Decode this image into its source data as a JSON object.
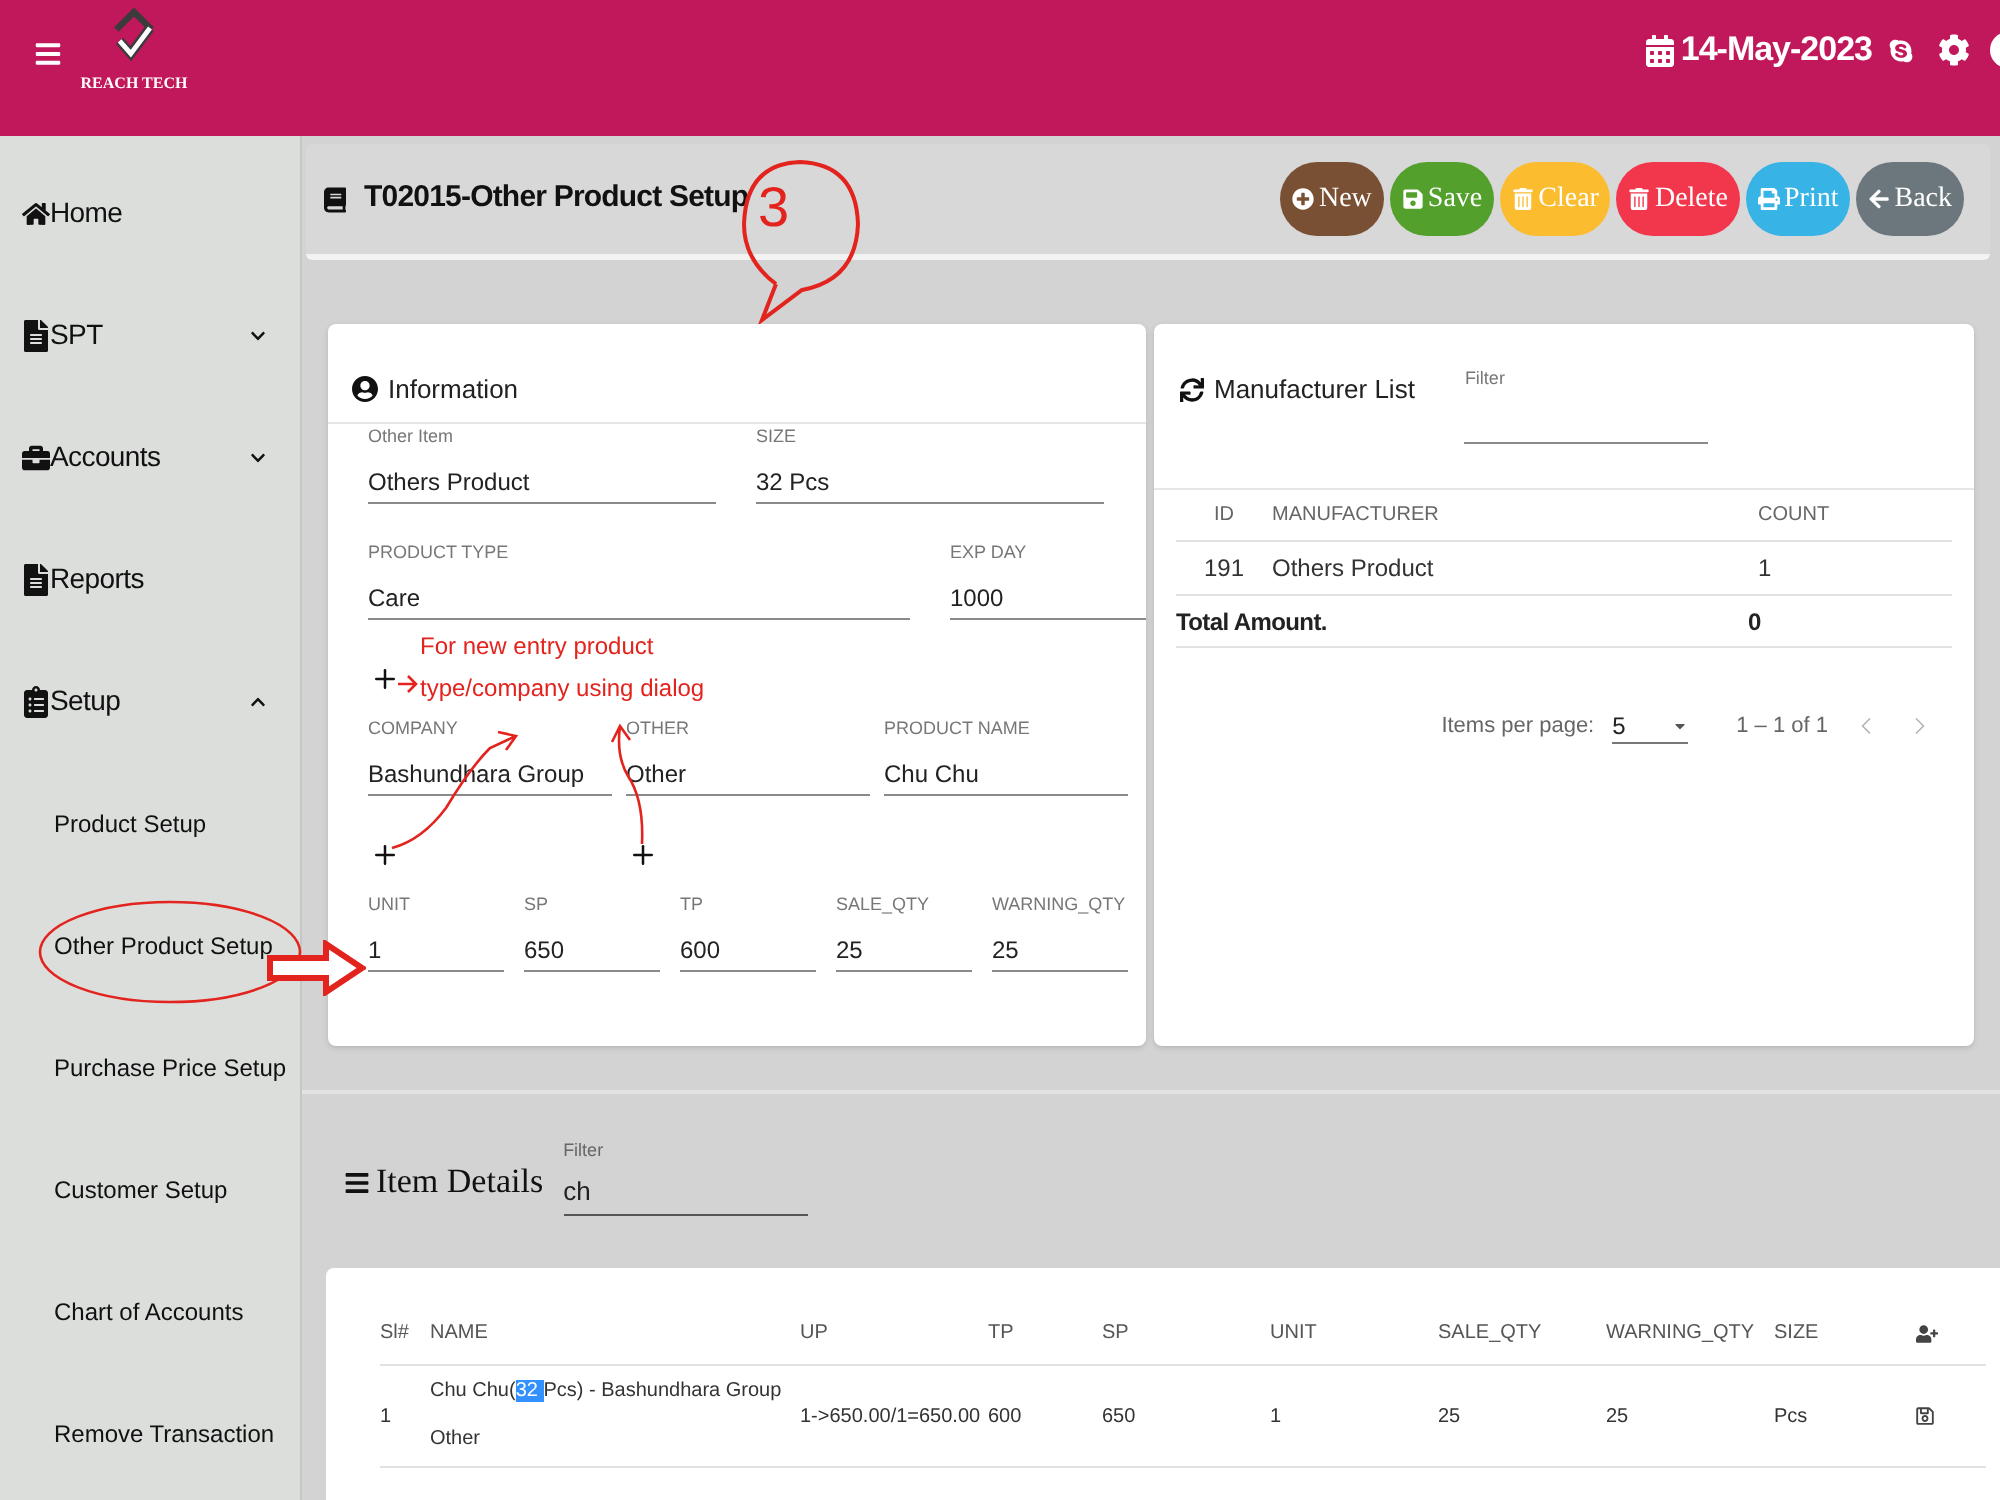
{
  "top_bar": {
    "logo_text": "REACH TECH",
    "date": "14-May-2023"
  },
  "sidebar": {
    "items": [
      {
        "label": "Home",
        "kind": "link"
      },
      {
        "label": "SPT",
        "kind": "group",
        "expanded": false
      },
      {
        "label": "Accounts",
        "kind": "group",
        "expanded": false
      },
      {
        "label": "Reports",
        "kind": "link"
      },
      {
        "label": "Setup",
        "kind": "group",
        "expanded": true,
        "children": [
          {
            "label": "Product Setup"
          },
          {
            "label": "Other Product Setup"
          },
          {
            "label": "Purchase Price Setup"
          },
          {
            "label": "Customer Setup"
          },
          {
            "label": "Chart of Accounts"
          },
          {
            "label": "Remove Transaction"
          }
        ]
      }
    ]
  },
  "page_header": {
    "title": "T02015-Other Product Setup",
    "buttons": [
      {
        "label": "New",
        "color": "#7a5034"
      },
      {
        "label": "Save",
        "color": "#53a02c"
      },
      {
        "label": "Clear",
        "color": "#fbbd2f"
      },
      {
        "label": "Delete",
        "color": "#f2364c"
      },
      {
        "label": "Print",
        "color": "#38b3e6"
      },
      {
        "label": "Back",
        "color": "#6c767d"
      }
    ]
  },
  "information": {
    "title": "Information",
    "rows": [
      [
        {
          "label": "Other Item",
          "value": "Others Product",
          "addable": false
        },
        {
          "label": "SIZE",
          "value": "32 Pcs",
          "addable": false
        }
      ],
      [
        {
          "label": "PRODUCT TYPE",
          "value": "Care",
          "addable": true
        },
        {
          "label": "EXP DAY",
          "value": "1000",
          "addable": false
        }
      ],
      [
        {
          "label": "COMPANY",
          "value": "Bashundhara Group",
          "addable": true
        },
        {
          "label": "OTHER",
          "value": "Other",
          "addable": true
        },
        {
          "label": "PRODUCT NAME",
          "value": "Chu Chu",
          "addable": false
        }
      ],
      [
        {
          "label": "UNIT",
          "value": "1",
          "addable": false
        },
        {
          "label": "SP",
          "value": "650",
          "addable": false
        },
        {
          "label": "TP",
          "value": "600",
          "addable": false
        },
        {
          "label": "SALE_QTY",
          "value": "25",
          "addable": false
        },
        {
          "label": "WARNING_QTY",
          "value": "25",
          "addable": false
        }
      ]
    ]
  },
  "manufacturer_list": {
    "title": "Manufacturer List",
    "filter": {
      "label": "Filter"
    },
    "columns": [
      "ID",
      "MANUFACTURER",
      "COUNT"
    ],
    "rows": [
      [
        "191",
        "Others Product",
        "1"
      ]
    ],
    "total": {
      "label": "Total Amount.",
      "value": "0"
    },
    "paginator": {
      "items_per_page_label": "Items per page:",
      "page_size": "5",
      "range": "1 – 1 of 1",
      "previous_disabled": true,
      "next_disabled": true
    }
  },
  "item_details": {
    "title": "Item Details",
    "filter": {
      "label": "Filter",
      "value": "ch"
    },
    "columns": [
      "Sl#",
      "NAME",
      "UP",
      "TP",
      "SP",
      "UNIT",
      "SALE_QTY",
      "WARNING_QTY",
      "SIZE"
    ],
    "rows": [
      {
        "sl": "1",
        "name_parts": [
          {
            "text": "Chu Chu(",
            "selected": false
          },
          {
            "text": "32 ",
            "selected": true
          },
          {
            "text": "Pcs) - Bashundhara Group",
            "selected": false
          }
        ],
        "category": "Other",
        "up": "1->650.00/1=650.00",
        "tp": "600",
        "sp": "650",
        "unit": "1",
        "sale_qty": "25",
        "warning_qty": "25",
        "size": "Pcs"
      }
    ]
  },
  "annotations": {
    "callout": "3",
    "note": "For new entry product type/company using dialog"
  }
}
